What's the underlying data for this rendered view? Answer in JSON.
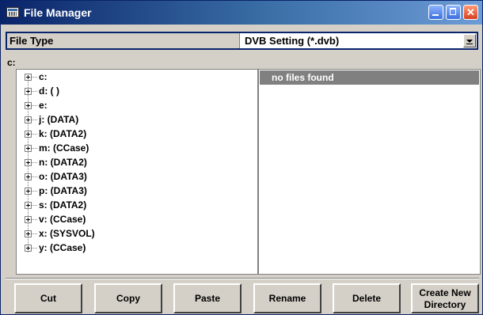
{
  "window": {
    "title": "File Manager",
    "icon": "file-manager-icon",
    "controls": [
      "minimize-icon",
      "maximize-icon",
      "close-icon"
    ]
  },
  "file_type": {
    "label": "File Type",
    "value": "DVB Setting (*.dvb)"
  },
  "current_path": "c:",
  "tree": {
    "items": [
      {
        "label": "c:"
      },
      {
        "label": "d: ( )"
      },
      {
        "label": "e:"
      },
      {
        "label": "j: (DATA)"
      },
      {
        "label": "k: (DATA2)"
      },
      {
        "label": "m: (CCase)"
      },
      {
        "label": "n: (DATA2)"
      },
      {
        "label": "o: (DATA3)"
      },
      {
        "label": "p: (DATA3)"
      },
      {
        "label": "s: (DATA2)"
      },
      {
        "label": "v: (CCase)"
      },
      {
        "label": "x: (SYSVOL)"
      },
      {
        "label": "y: (CCase)"
      }
    ]
  },
  "files": {
    "empty_message": "no files found"
  },
  "buttons": {
    "cut": "Cut",
    "copy": "Copy",
    "paste": "Paste",
    "rename": "Rename",
    "delete": "Delete",
    "create_dir_line1": "Create New",
    "create_dir_line2": "Directory"
  },
  "colors": {
    "title_bar": "#0a246a",
    "face": "#d4d0c8",
    "files_header": "#808080",
    "close_button": "#d6401b"
  }
}
